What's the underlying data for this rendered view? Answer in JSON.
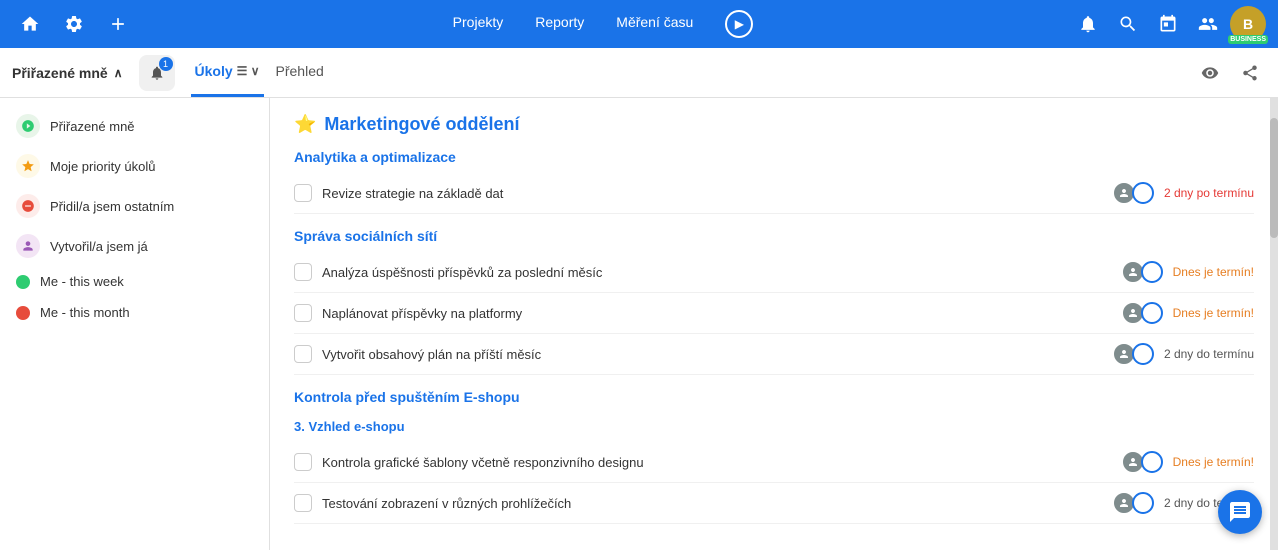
{
  "topNav": {
    "homeIcon": "⌂",
    "gearIcon": "⚙",
    "plusIcon": "+",
    "centerLinks": [
      "Projekty",
      "Reporty",
      "Měření času"
    ],
    "bellIcon": "🔔",
    "searchIcon": "🔍",
    "calendarIcon": "📅",
    "usersIcon": "👥",
    "playLabel": "▶",
    "avatarLabel": "B",
    "avatarBadge": "BUSINESS"
  },
  "subHeader": {
    "assignedTitle": "Přiřazené mně",
    "notificationCount": "1",
    "tabs": [
      {
        "label": "Úkoly",
        "active": true,
        "hasFilter": true
      },
      {
        "label": "Přehled",
        "active": false
      }
    ],
    "settingsIcon": "⚙",
    "shareIcon": "↑"
  },
  "sidebar": {
    "items": [
      {
        "id": "assigned",
        "label": "Přiřazené mně",
        "iconType": "circle",
        "iconColor": "#2ecc71",
        "iconText": "👤"
      },
      {
        "id": "priorities",
        "label": "Moje priority úkolů",
        "iconType": "circle",
        "iconColor": "#f39c12",
        "iconText": "⭐"
      },
      {
        "id": "assigned-others",
        "label": "Přidil/a jsem ostatním",
        "iconType": "circle",
        "iconColor": "#e74c3c",
        "iconText": "↗"
      },
      {
        "id": "created",
        "label": "Vytvořil/a jsem já",
        "iconType": "circle",
        "iconColor": "#9b59b6",
        "iconText": "👤"
      },
      {
        "id": "this-week",
        "label": "Me - this week",
        "dotColor": "#2ecc71"
      },
      {
        "id": "this-month",
        "label": "Me - this month",
        "dotColor": "#e74c3c"
      }
    ]
  },
  "content": {
    "sectionIcon": "⭐",
    "sectionTitle": "Marketingové oddělení",
    "groups": [
      {
        "id": "analytika",
        "title": "Analytika a optimalizace",
        "tasks": [
          {
            "name": "Revize strategie na základě dat",
            "avatars": [
              {
                "color": "#7f8c8d"
              },
              {
                "type": "ring",
                "color": "#1a73e8"
              }
            ],
            "dateLabel": "2 dny po termínu",
            "dateClass": "due-overdue"
          }
        ]
      },
      {
        "id": "social",
        "title": "Správa sociálních sítí",
        "tasks": [
          {
            "name": "Analýza úspěšnosti příspěvků za poslední měsíc",
            "avatars": [
              {
                "color": "#7f8c8d"
              },
              {
                "type": "ring",
                "color": "#1a73e8"
              }
            ],
            "dateLabel": "Dnes je termín!",
            "dateClass": "due-today"
          },
          {
            "name": "Naplánovat příspěvky na platformy",
            "avatars": [
              {
                "color": "#7f8c8d"
              },
              {
                "type": "ring",
                "color": "#1a73e8"
              }
            ],
            "dateLabel": "Dnes je termín!",
            "dateClass": "due-today"
          },
          {
            "name": "Vytvořit obsahový plán na příští měsíc",
            "avatars": [
              {
                "color": "#7f8c8d"
              },
              {
                "type": "ring",
                "color": "#1a73e8"
              }
            ],
            "dateLabel": "2 dny do termínu",
            "dateClass": "due-ok"
          }
        ]
      },
      {
        "id": "eshop",
        "title": "Kontrola před spuštěním E-shopu",
        "subsections": [
          {
            "label": "3. Vzhled e-shopu",
            "tasks": [
              {
                "name": "Kontrola grafické šablony včetně responzivního designu",
                "avatars": [
                  {
                    "color": "#7f8c8d"
                  },
                  {
                    "type": "ring",
                    "color": "#1a73e8"
                  }
                ],
                "dateLabel": "Dnes je termín!",
                "dateClass": "due-today"
              },
              {
                "name": "Testování zobrazení v různých prohlížečích",
                "avatars": [
                  {
                    "color": "#7f8c8d"
                  },
                  {
                    "type": "ring",
                    "color": "#1a73e8"
                  }
                ],
                "dateLabel": "2 dny do termínu",
                "dateClass": "due-ok",
                "partial": true
              }
            ]
          }
        ]
      }
    ]
  }
}
